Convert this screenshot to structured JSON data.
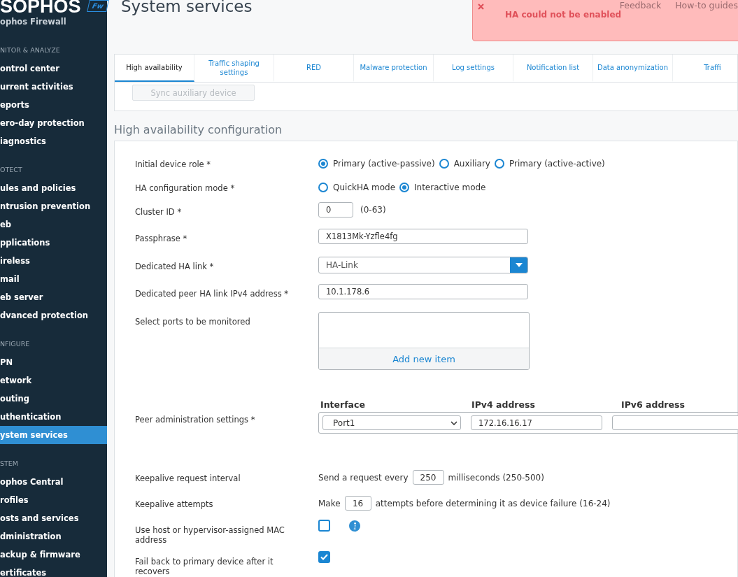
{
  "sidebar": {
    "logo": "SOPHOS",
    "badge": "Fw",
    "product": "ophos Firewall",
    "sections": [
      {
        "heading": "NITOR & ANALYZE",
        "items": [
          {
            "label": "ontrol center",
            "selected": false
          },
          {
            "label": "urrent activities",
            "selected": false
          },
          {
            "label": "eports",
            "selected": false
          },
          {
            "label": "ero-day protection",
            "selected": false
          },
          {
            "label": "iagnostics",
            "selected": false
          }
        ]
      },
      {
        "heading": "OTECT",
        "items": [
          {
            "label": "ules and policies",
            "selected": false
          },
          {
            "label": "ntrusion prevention",
            "selected": false
          },
          {
            "label": "eb",
            "selected": false
          },
          {
            "label": "pplications",
            "selected": false
          },
          {
            "label": "ireless",
            "selected": false
          },
          {
            "label": "mail",
            "selected": false
          },
          {
            "label": "eb server",
            "selected": false
          },
          {
            "label": "dvanced protection",
            "selected": false
          }
        ]
      },
      {
        "heading": "NFIGURE",
        "items": [
          {
            "label": "PN",
            "selected": false
          },
          {
            "label": "etwork",
            "selected": false
          },
          {
            "label": "outing",
            "selected": false
          },
          {
            "label": "uthentication",
            "selected": false
          },
          {
            "label": "ystem services",
            "selected": true
          }
        ]
      },
      {
        "heading": "STEM",
        "items": [
          {
            "label": "ophos Central",
            "selected": false
          },
          {
            "label": "rofiles",
            "selected": false
          },
          {
            "label": "osts and services",
            "selected": false
          },
          {
            "label": "dministration",
            "selected": false
          },
          {
            "label": "ackup & firmware",
            "selected": false
          },
          {
            "label": "ertificates",
            "selected": false
          }
        ]
      }
    ]
  },
  "header": {
    "title": "System services",
    "links": [
      "Feedback",
      "How-to guides"
    ]
  },
  "toast": {
    "message": "HA could not be enabled"
  },
  "tabs": [
    {
      "label": "High availability",
      "selected": true
    },
    {
      "label": "Traffic shaping settings",
      "selected": false
    },
    {
      "label": "RED",
      "selected": false
    },
    {
      "label": "Malware protection",
      "selected": false
    },
    {
      "label": "Log settings",
      "selected": false
    },
    {
      "label": "Notification list",
      "selected": false
    },
    {
      "label": "Data anonymization",
      "selected": false
    },
    {
      "label": "Traffi",
      "selected": false
    }
  ],
  "sync_button": {
    "label": "Sync auxiliary device",
    "disabled": true
  },
  "section_title": "High availability configuration",
  "form": {
    "rows": [
      {
        "kind": "radio",
        "label": "Initial device role *",
        "options": [
          {
            "label": "Primary (active-passive)",
            "selected": true
          },
          {
            "label": "Auxiliary",
            "selected": false
          },
          {
            "label": "Primary (active-active)",
            "selected": false
          }
        ]
      },
      {
        "kind": "radio",
        "label": "HA configuration mode *",
        "options": [
          {
            "label": "QuickHA mode",
            "selected": false
          },
          {
            "label": "Interactive mode",
            "selected": true
          }
        ]
      },
      {
        "kind": "number",
        "label": "Cluster ID *",
        "value": "0",
        "hint": "(0-63)"
      },
      {
        "kind": "text",
        "label": "Passphrase *",
        "value": "X1813Mk-Yzfle4fg"
      },
      {
        "kind": "select",
        "label": "Dedicated HA link *",
        "value": "HA-Link"
      },
      {
        "kind": "text",
        "label": "Dedicated peer HA link IPv4 address *",
        "value": "10.1.178.6"
      },
      {
        "kind": "list",
        "label": "Select ports to be monitored",
        "action": "Add new item"
      },
      {
        "kind": "peer",
        "label": "Peer administration settings *",
        "columns": [
          "Interface",
          "IPv4 address",
          "IPv6 address"
        ],
        "interface": "Port1",
        "ipv4": "172.16.16.17"
      },
      {
        "kind": "inline",
        "label": "Keepalive request interval",
        "prefix": "Send a request every",
        "value": "250",
        "suffix": "milliseconds (250-500)"
      },
      {
        "kind": "inline",
        "label": "Keepalive attempts",
        "prefix": "Make",
        "value": "16",
        "suffix": "attempts before determining it as device failure (16-24)"
      },
      {
        "kind": "checkbox",
        "label": "Use host or hypervisor-assigned MAC address",
        "checked": false,
        "info": true
      },
      {
        "kind": "checkbox",
        "label": "Fail back to primary device after it recovers",
        "checked": true,
        "info": false
      }
    ]
  }
}
